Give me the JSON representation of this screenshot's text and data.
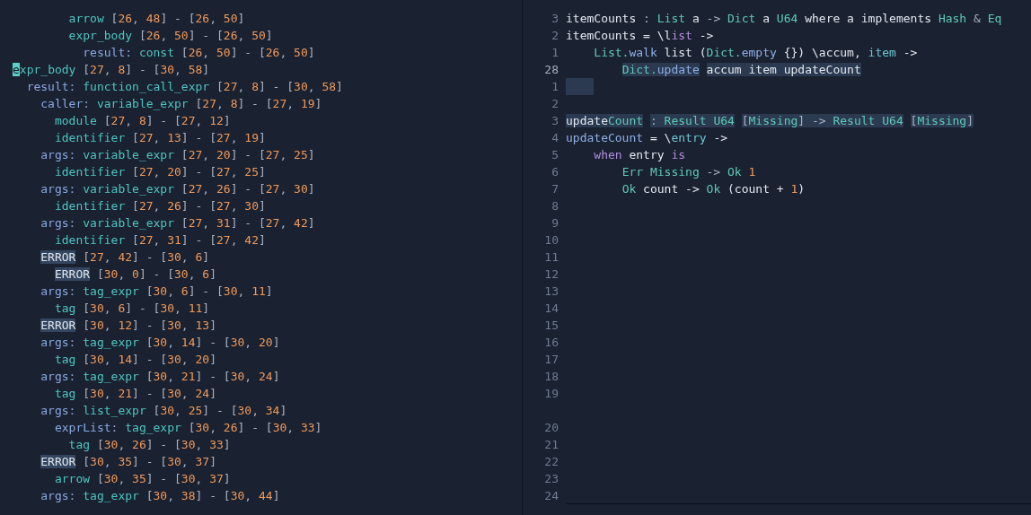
{
  "tree": {
    "nodes": [
      {
        "children": [
          {
            "children": [
              {
                "children": [
                  {
                    "children": [
                      {
                        "type": "arrow",
                        "range": "[26, 48] - [26, 50]"
                      },
                      {
                        "type": "expr_body",
                        "range": "[26, 50] - [26, 50]",
                        "children": [
                          {
                            "field": "result:",
                            "type": "const",
                            "range": "[26, 50] - [26, 50]"
                          }
                        ]
                      }
                    ]
                  }
                ]
              }
            ]
          }
        ]
      },
      {
        "type": "expr_body",
        "range": "[27, 8] - [30, 58]",
        "cursor": true,
        "children": [
          {
            "field": "result:",
            "type": "function_call_expr",
            "range": "[27, 8] - [30, 58]",
            "children": [
              {
                "field": "caller:",
                "type": "variable_expr",
                "range": "[27, 8] - [27, 19]",
                "children": [
                  {
                    "type": "module",
                    "range": "[27, 8] - [27, 12]"
                  },
                  {
                    "type": "identifier",
                    "range": "[27, 13] - [27, 19]"
                  }
                ]
              },
              {
                "field": "args:",
                "type": "variable_expr",
                "range": "[27, 20] - [27, 25]",
                "children": [
                  {
                    "type": "identifier",
                    "range": "[27, 20] - [27, 25]"
                  }
                ]
              },
              {
                "field": "args:",
                "type": "variable_expr",
                "range": "[27, 26] - [27, 30]",
                "children": [
                  {
                    "type": "identifier",
                    "range": "[27, 26] - [27, 30]"
                  }
                ]
              },
              {
                "field": "args:",
                "type": "variable_expr",
                "range": "[27, 31] - [27, 42]",
                "children": [
                  {
                    "type": "identifier",
                    "range": "[27, 31] - [27, 42]"
                  }
                ]
              },
              {
                "type": "ERROR",
                "error": true,
                "range": "[27, 42] - [30, 6]",
                "children": [
                  {
                    "type": "ERROR",
                    "error": true,
                    "range": "[30, 0] - [30, 6]"
                  }
                ]
              },
              {
                "field": "args:",
                "type": "tag_expr",
                "range": "[30, 6] - [30, 11]",
                "children": [
                  {
                    "type": "tag",
                    "range": "[30, 6] - [30, 11]"
                  }
                ]
              },
              {
                "type": "ERROR",
                "error": true,
                "range": "[30, 12] - [30, 13]"
              },
              {
                "field": "args:",
                "type": "tag_expr",
                "range": "[30, 14] - [30, 20]",
                "children": [
                  {
                    "type": "tag",
                    "range": "[30, 14] - [30, 20]"
                  }
                ]
              },
              {
                "field": "args:",
                "type": "tag_expr",
                "range": "[30, 21] - [30, 24]",
                "children": [
                  {
                    "type": "tag",
                    "range": "[30, 21] - [30, 24]"
                  }
                ]
              },
              {
                "field": "args:",
                "type": "list_expr",
                "range": "[30, 25] - [30, 34]",
                "children": [
                  {
                    "field": "exprList:",
                    "type": "tag_expr",
                    "range": "[30, 26] - [30, 33]",
                    "children": [
                      {
                        "type": "tag",
                        "range": "[30, 26] - [30, 33]"
                      }
                    ]
                  }
                ]
              },
              {
                "type": "ERROR",
                "error": true,
                "range": "[30, 35] - [30, 37]",
                "children": [
                  {
                    "type": "arrow",
                    "range": "[30, 35] - [30, 37]"
                  }
                ]
              },
              {
                "field": "args:",
                "type": "tag_expr",
                "range": "[30, 38] - [30, 44]"
              }
            ]
          }
        ]
      }
    ]
  },
  "editor": {
    "lines": [
      {
        "number": "3",
        "tokens": [
          {
            "text": "itemCounts",
            "kind": "plain"
          },
          {
            "text": " : ",
            "kind": "punct"
          },
          {
            "text": "List",
            "kind": "type"
          },
          {
            "text": " a ",
            "kind": "plain"
          },
          {
            "text": "-> ",
            "kind": "punct"
          },
          {
            "text": "Dict",
            "kind": "type"
          },
          {
            "text": " a ",
            "kind": "plain"
          },
          {
            "text": "U64",
            "kind": "type"
          },
          {
            "text": " where a implements ",
            "kind": "plain"
          },
          {
            "text": "Hash",
            "kind": "type"
          },
          {
            "text": " & ",
            "kind": "punct"
          },
          {
            "text": "Eq",
            "kind": "type"
          }
        ]
      },
      {
        "number": "2",
        "tokens": [
          {
            "text": "itemCounts = \\l",
            "kind": "plain"
          },
          {
            "text": "ist",
            "kind": "keyword"
          },
          {
            "text": " ->",
            "kind": "plain"
          }
        ]
      },
      {
        "number": "1",
        "tokens": [
          {
            "text": "    List.",
            "kind": "type"
          },
          {
            "text": "walk",
            "kind": "func"
          },
          {
            "text": " list (",
            "kind": "plain"
          },
          {
            "text": "Dict.",
            "kind": "type"
          },
          {
            "text": "empty",
            "kind": "func"
          },
          {
            "text": " {}) \\accum, ",
            "kind": "plain"
          },
          {
            "text": "item",
            "kind": "param"
          },
          {
            "text": " ->",
            "kind": "plain"
          }
        ]
      },
      {
        "number": "28",
        "current": true,
        "tokens": [
          {
            "text": "        Dict.",
            "kind": "type",
            "highlighted": true
          },
          {
            "text": "update",
            "kind": "func",
            "highlighted": true
          },
          {
            "text": " accum item updateCount",
            "kind": "plain",
            "highlighted": true
          }
        ]
      },
      {
        "number": "1",
        "selection": true
      },
      {
        "number": "2"
      },
      {
        "number": "3",
        "tokens": [
          {
            "text": "update",
            "kind": "plain",
            "highlighted": true
          },
          {
            "text": "Count",
            "kind": "type",
            "highlighted": true
          },
          {
            "text": " : ",
            "kind": "punct",
            "highlighted": true
          },
          {
            "text": "Result U64",
            "kind": "type",
            "highlighted": true
          },
          {
            "text": " [",
            "kind": "punct",
            "highlighted": true
          },
          {
            "text": "Missing",
            "kind": "type",
            "highlighted": true
          },
          {
            "text": "] -> ",
            "kind": "punct",
            "highlighted": true
          },
          {
            "text": "Result U64",
            "kind": "type",
            "highlighted": true
          },
          {
            "text": " [",
            "kind": "punct",
            "highlighted": true
          },
          {
            "text": "Missing",
            "kind": "type",
            "highlighted": true
          },
          {
            "text": "]",
            "kind": "punct",
            "highlighted": true
          }
        ]
      },
      {
        "number": "4",
        "tokens": [
          {
            "text": "updateCount",
            "kind": "func"
          },
          {
            "text": " = \\",
            "kind": "plain"
          },
          {
            "text": "entry",
            "kind": "param"
          },
          {
            "text": " ->",
            "kind": "plain"
          }
        ]
      },
      {
        "number": "5",
        "tokens": [
          {
            "text": "    when",
            "kind": "keyword"
          },
          {
            "text": " entry ",
            "kind": "plain"
          },
          {
            "text": "is",
            "kind": "keyword"
          }
        ]
      },
      {
        "number": "6",
        "tokens": [
          {
            "text": "        Err Missing",
            "kind": "type"
          },
          {
            "text": " -> ",
            "kind": "punct"
          },
          {
            "text": "Ok",
            "kind": "type"
          },
          {
            "text": " 1",
            "kind": "number"
          }
        ]
      },
      {
        "number": "7",
        "tokens": [
          {
            "text": "        Ok",
            "kind": "type"
          },
          {
            "text": " count -> ",
            "kind": "plain"
          },
          {
            "text": "Ok",
            "kind": "type"
          },
          {
            "text": " (count + ",
            "kind": "plain"
          },
          {
            "text": "1",
            "kind": "number"
          },
          {
            "text": ")",
            "kind": "plain"
          }
        ]
      },
      {
        "number": "8"
      },
      {
        "number": "9"
      },
      {
        "number": "10"
      },
      {
        "number": "11"
      },
      {
        "number": "12"
      },
      {
        "number": "13"
      },
      {
        "number": "14"
      },
      {
        "number": "15"
      },
      {
        "number": "16"
      },
      {
        "number": "17"
      },
      {
        "number": "18"
      },
      {
        "number": "19",
        "wrap_below": true
      },
      {
        "number": "20"
      },
      {
        "number": "21"
      },
      {
        "number": "22"
      },
      {
        "number": "23"
      },
      {
        "number": "24",
        "rule_below": true
      }
    ]
  }
}
